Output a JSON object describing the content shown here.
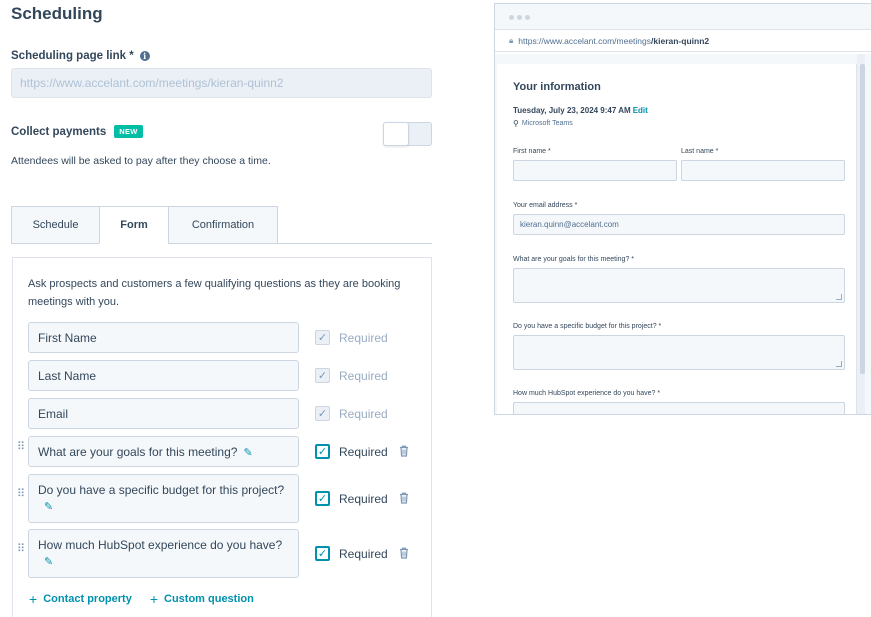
{
  "page": {
    "title": "Scheduling",
    "link_label": "Scheduling page link *",
    "link_placeholder": "https://www.accelant.com/meetings/kieran-quinn2",
    "collect_label": "Collect payments",
    "new_badge": "NEW",
    "collect_desc": "Attendees will be asked to pay after they choose a time.",
    "payments_enabled": false
  },
  "tabs": [
    {
      "label": "Schedule",
      "active": false
    },
    {
      "label": "Form",
      "active": true
    },
    {
      "label": "Confirmation",
      "active": false
    }
  ],
  "form": {
    "description": "Ask prospects and customers a few qualifying questions as they are booking meetings with you.",
    "required_label": "Required",
    "fields": [
      {
        "label": "First Name",
        "required": true,
        "locked": true
      },
      {
        "label": "Last Name",
        "required": true,
        "locked": true
      },
      {
        "label": "Email",
        "required": true,
        "locked": true
      },
      {
        "label": "What are your goals for this meeting?",
        "required": true,
        "locked": false
      },
      {
        "label": "Do you have a specific budget for this project?",
        "required": true,
        "locked": false
      },
      {
        "label": "How much HubSpot experience do you have?",
        "required": true,
        "locked": false
      }
    ],
    "add_contact_property": "Contact property",
    "add_custom_question": "Custom question"
  },
  "preview": {
    "url_prefix": "https://www.accelant.com/meetings",
    "url_slug": "/kieran-quinn2",
    "title": "Your information",
    "datetime": "Tuesday, July 23, 2024 9:47 AM",
    "edit": "Edit",
    "location": "Microsoft Teams",
    "first_name_label": "First name *",
    "last_name_label": "Last name *",
    "email_label": "Your email address *",
    "email_value": "kieran.quinn@accelant.com",
    "goals_label": "What are your goals for this meeting? *",
    "budget_label": "Do you have a specific budget for this project? *",
    "experience_label": "How much HubSpot experience do you have? *"
  },
  "colors": {
    "accent": "#0091ae",
    "badge": "#00bda5",
    "text": "#33475b"
  }
}
